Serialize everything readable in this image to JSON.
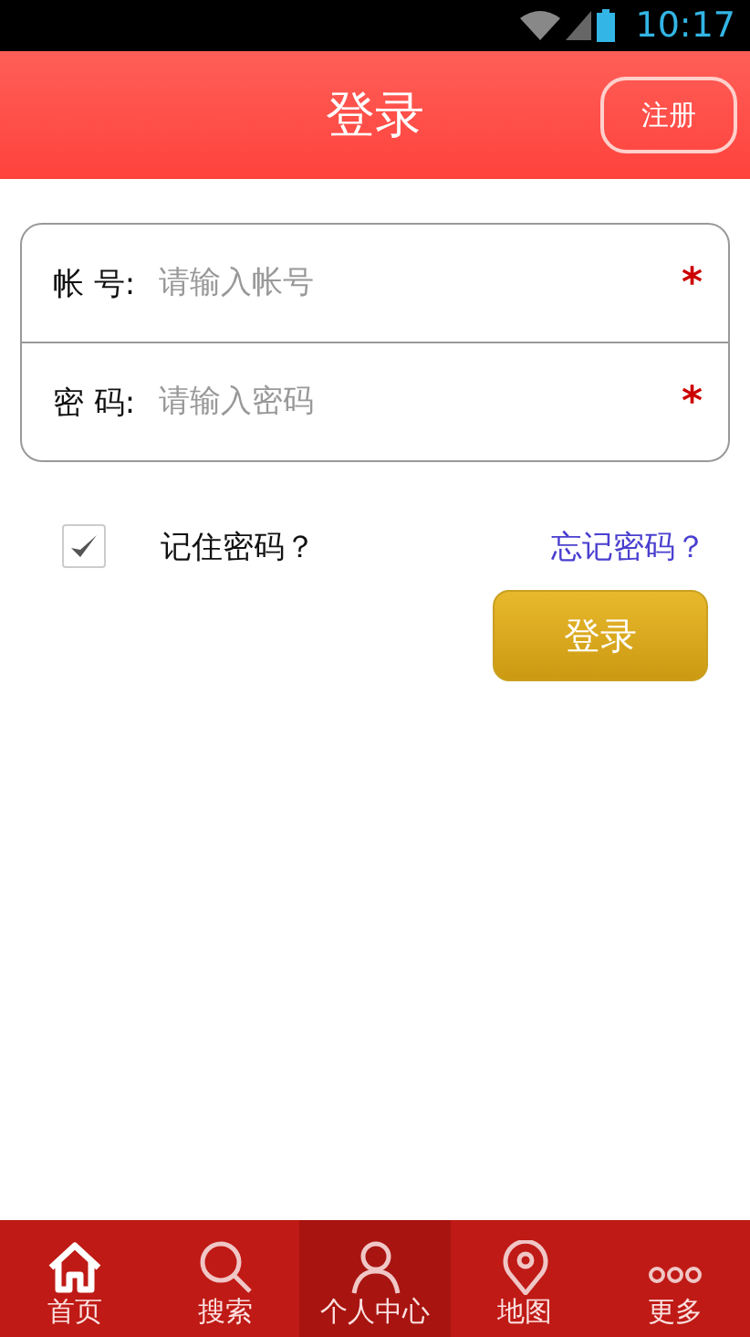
{
  "status_bar": {
    "time": "10:17"
  },
  "header": {
    "title": "登录",
    "register_button": "注册"
  },
  "form": {
    "fields": [
      {
        "label": "帐 号:",
        "placeholder": "请输入帐号",
        "required_mark": "*"
      },
      {
        "label": "密 码:",
        "placeholder": "请输入密码",
        "required_mark": "*"
      }
    ]
  },
  "remember": {
    "label": "记住密码？",
    "checked": true
  },
  "forgot_link": "忘记密码？",
  "login_button": "登录",
  "tab_bar": [
    {
      "label": "首页",
      "kind": "home",
      "selected": false
    },
    {
      "label": "搜索",
      "kind": "search",
      "selected": false
    },
    {
      "label": "个人中心",
      "kind": "person",
      "selected": true
    },
    {
      "label": "地图",
      "kind": "map",
      "selected": false
    },
    {
      "label": "更多",
      "kind": "more",
      "selected": false
    }
  ]
}
